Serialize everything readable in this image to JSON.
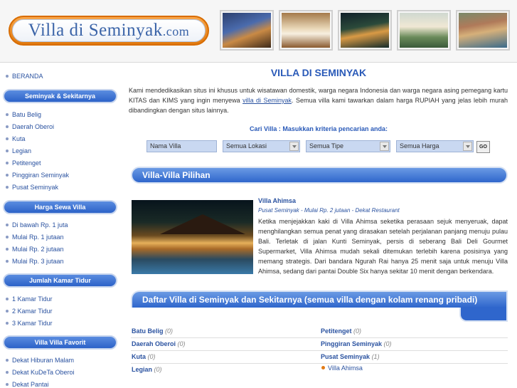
{
  "header": {
    "logo_main": "Villa di Seminyak",
    "logo_suffix": ".com",
    "photos": [
      "villa-pool-night-photo",
      "bedroom-photo",
      "pool-evening-photo",
      "living-area-photo",
      "garden-pool-photo"
    ]
  },
  "sidebar": {
    "home": "BERANDA",
    "sections": [
      {
        "title": "Seminyak & Sekitarnya",
        "items": [
          "Batu Belig",
          "Daerah Oberoi",
          "Kuta",
          "Legian",
          "Petitenget",
          "Pinggiran Seminyak",
          "Pusat Seminyak"
        ]
      },
      {
        "title": "Harga Sewa Villa",
        "items": [
          "Di bawah Rp. 1 juta",
          "Mulai Rp. 1 jutaan",
          "Mulai Rp. 2 jutaan",
          "Mulai Rp. 3 jutaan"
        ]
      },
      {
        "title": "Jumlah Kamar Tidur",
        "items": [
          "1 Kamar Tidur",
          "2 Kamar Tidur",
          "3 Kamar Tidur"
        ]
      },
      {
        "title": "Villa Villa Favorit",
        "items": [
          "Dekat Hiburan Malam",
          "Dekat KuDeTa Oberoi",
          "Dekat Pantai"
        ]
      }
    ]
  },
  "main": {
    "title": "VILLA DI SEMINYAK",
    "intro_before": "Kami mendedikasikan situs ini khusus untuk wisatawan domestik, warga negara Indonesia dan warga negara asing pemegang kartu KITAS dan KIMS yang ingin menyewa ",
    "intro_link": "villa di Seminyak",
    "intro_after": ". Semua villa kami tawarkan dalam harga RUPIAH yang jelas lebih murah dibandingkan dengan situs lainnya.",
    "search": {
      "title": "Cari Villa : Masukkan kriteria pencarian anda:",
      "name_placeholder": "Nama Villa",
      "location": "Semua Lokasi",
      "type": "Semua Tipe",
      "price": "Semua Harga",
      "go": "GO"
    },
    "featured_heading": "Villa-Villa Pilihan",
    "featured": {
      "name": "Villa Ahimsa",
      "subtitle": "Pusat Seminyak - Mulai Rp. 2 jutaan - Dekat Restaurant",
      "description": "Ketika menjejakkan kaki di Villa Ahimsa seketika perasaan sejuk menyeruak, dapat menghilangkan semua penat yang dirasakan setelah perjalanan panjang menuju pulau Bali. Terletak di jalan Kunti Seminyak, persis di seberang Bali Deli Gourmet Supermarket, Villa Ahimsa mudah sekali ditemukan terlebih karena posisinya yang memang strategis. Dari bandara Ngurah Rai hanya 25 menit saja untuk menuju Villa Ahimsa, sedang dari pantai Double Six hanya sekitar 10 menit dengan berkendara."
    },
    "list_heading": "Daftar Villa di Seminyak dan Sekitarnya (semua villa dengan kolam renang pribadi)",
    "list_left": [
      {
        "name": "Batu Belig",
        "count": "(0)"
      },
      {
        "name": "Daerah Oberoi",
        "count": "(0)"
      },
      {
        "name": "Kuta",
        "count": "(0)"
      },
      {
        "name": "Legian",
        "count": "(0)"
      }
    ],
    "list_right": [
      {
        "name": "Petitenget",
        "count": "(0)"
      },
      {
        "name": "Pinggiran Seminyak",
        "count": "(0)"
      },
      {
        "name": "Pusat Seminyak",
        "count": "(1)"
      }
    ],
    "list_sub": "Villa Ahimsa"
  },
  "colors": {
    "accent": "#2f66cc",
    "link": "#2a52a0",
    "logo_orange": "#e07a10"
  }
}
